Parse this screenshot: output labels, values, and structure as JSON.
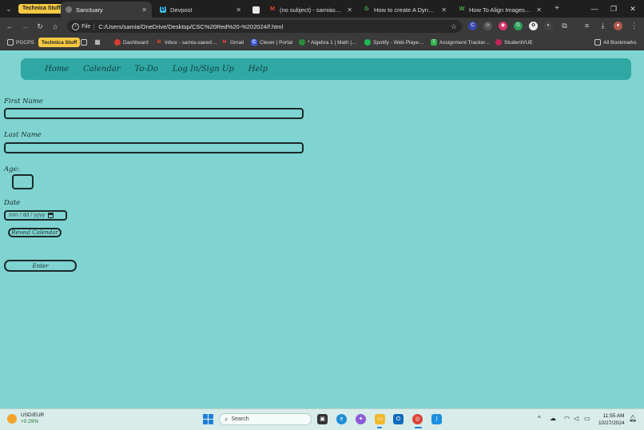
{
  "browser": {
    "tab_group_label": "Technica Stuff",
    "tabs": [
      {
        "title": "Sanctuary",
        "active": true
      },
      {
        "title": "Devpost",
        "active": false
      },
      {
        "title": "",
        "active": false
      },
      {
        "title": "(no subject) - samiasaeed4…",
        "active": false
      },
      {
        "title": "How to create A Dynamic C…",
        "active": false
      },
      {
        "title": "How To Align Images Side S…",
        "active": false
      }
    ],
    "omnibox": {
      "scheme_label": "File",
      "url": "C:/Users/samia/OneDrive/Desktop/CSC%20Red%20-%202024/f.html"
    },
    "bookmarks": [
      {
        "label": "PGCPS",
        "icon": "folder-icon"
      },
      {
        "label": "Technica Stuff",
        "icon": "group-chip"
      },
      {
        "label": "",
        "icon": "blank-page-icon"
      },
      {
        "label": "",
        "icon": "apps-grid-icon"
      },
      {
        "label": "Dashboard",
        "icon": "canvas-icon"
      },
      {
        "label": "Inbox - samia-saeed…",
        "icon": "gmail-icon"
      },
      {
        "label": "Gmail",
        "icon": "gmail-icon"
      },
      {
        "label": "Clever | Portal",
        "icon": "clever-icon"
      },
      {
        "label": "* Algebra 1 | Math |…",
        "icon": "math-icon"
      },
      {
        "label": "Spotify - Web Playe…",
        "icon": "spotify-icon"
      },
      {
        "label": "Assignment Tracker…",
        "icon": "tracker-icon"
      },
      {
        "label": "StudentVUE",
        "icon": "studentvue-icon"
      }
    ],
    "all_bookmarks_label": "All Bookmarks"
  },
  "site": {
    "nav": [
      "Home",
      "Calendar",
      "To-Do",
      "Log In/Sign Up",
      "Help"
    ],
    "form": {
      "first_name_label": "First Name",
      "first_name_value": "",
      "last_name_label": "Last Name",
      "last_name_value": "",
      "age_label": "Age:",
      "age_value": "",
      "date_label": "Date",
      "date_placeholder": "mm / dd / yyyy",
      "reveal_calendar_label": "Reveal Calendar",
      "enter_label": "Enter"
    }
  },
  "taskbar": {
    "weather": {
      "title": "USD/EUR",
      "change": "+0.29%"
    },
    "search_placeholder": "Search",
    "clock": {
      "time": "11:55 AM",
      "date": "10/27/2024"
    }
  },
  "colors": {
    "page_bg": "#7fd3d0",
    "nav_bg": "#2fa8a4",
    "accent_yellow": "#f3c843"
  }
}
